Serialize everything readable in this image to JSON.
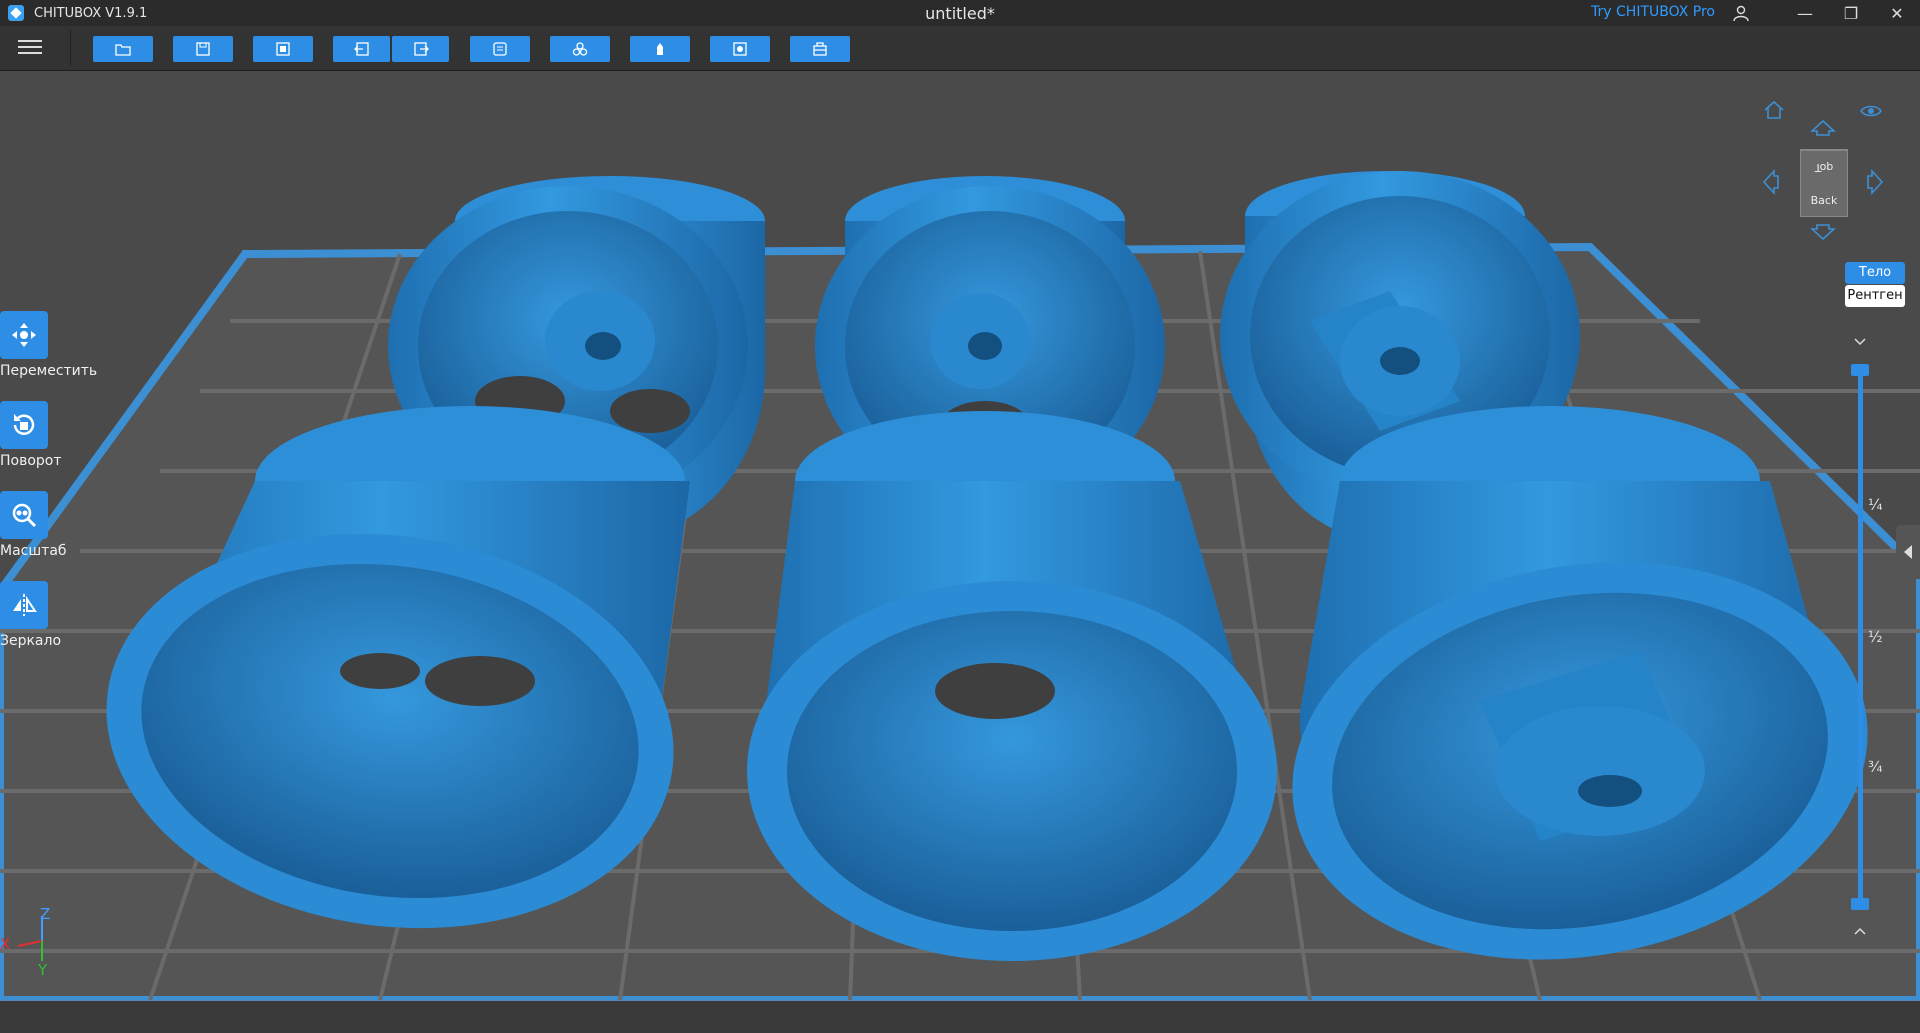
{
  "titlebar": {
    "app_name": "CHITUBOX V1.9.1",
    "document_title": "untitled*",
    "pro_link": "Try CHITUBOX Pro",
    "minimize": "—",
    "maximize": "❐",
    "close": "✕"
  },
  "toolbar": {
    "buttons": [
      "open-file-icon",
      "save-icon",
      "import-icon",
      "undo-icon",
      "redo-icon",
      "layout-icon",
      "copy-icon",
      "support-icon",
      "hollow-icon",
      "slice-icon"
    ]
  },
  "left_tools": [
    {
      "label": "Переместить",
      "icon": "move-icon"
    },
    {
      "label": "Поворот",
      "icon": "rotate-icon"
    },
    {
      "label": "Масштаб",
      "icon": "scale-icon"
    },
    {
      "label": "Зеркало",
      "icon": "mirror-icon"
    }
  ],
  "view_controls": {
    "cube_top": "Top",
    "cube_back": "Back",
    "mode_body": "Тело",
    "mode_xray": "Рентген"
  },
  "layer_slider": {
    "ticks": [
      "¼",
      "½",
      "¾"
    ],
    "value_min": 0,
    "value_max": 1
  },
  "axes": {
    "x": "X",
    "y": "Y",
    "z": "Z"
  },
  "colors": {
    "accent": "#2e8ee6",
    "model": "#2d8fd8",
    "plate_border": "#3d8fd4",
    "grid": "#6b6b6b"
  }
}
